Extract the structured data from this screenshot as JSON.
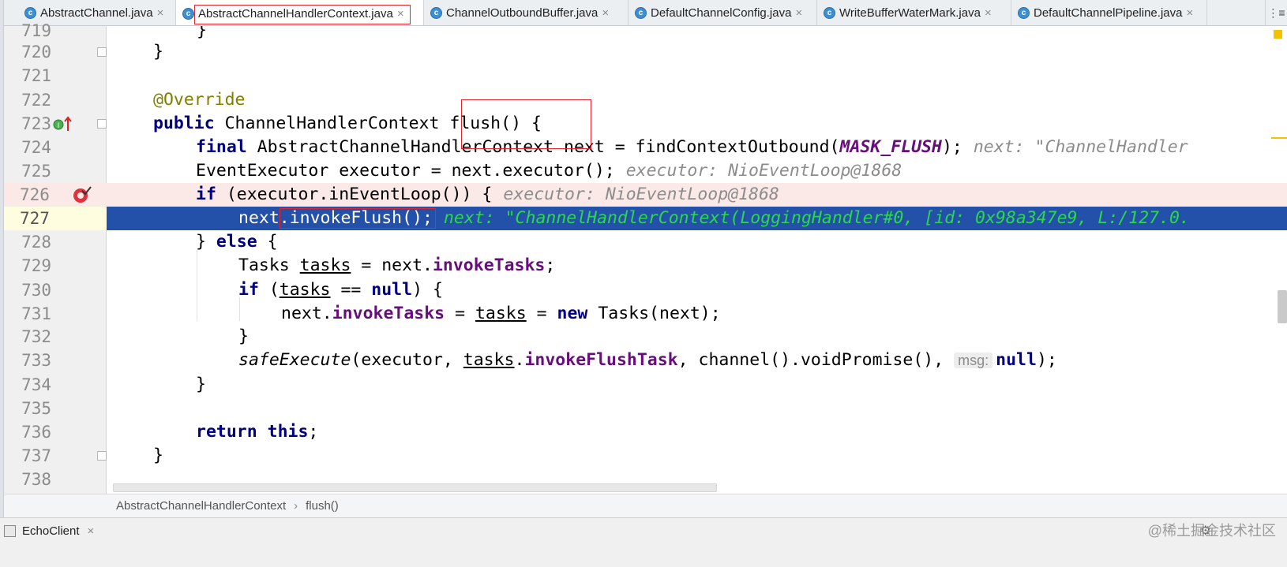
{
  "tabs": [
    {
      "label": "AbstractChannel.java",
      "active": false
    },
    {
      "label": "AbstractChannelHandlerContext.java",
      "active": true
    },
    {
      "label": "ChannelOutboundBuffer.java",
      "active": false
    },
    {
      "label": "DefaultChannelConfig.java",
      "active": false
    },
    {
      "label": "WriteBufferWaterMark.java",
      "active": false
    },
    {
      "label": "DefaultChannelPipeline.java",
      "active": false
    }
  ],
  "tab_icon_letter": "c",
  "tab_close": "×",
  "tab_menu": "⋮≡",
  "line_numbers": [
    "719",
    "720",
    "721",
    "722",
    "723",
    "724",
    "725",
    "726",
    "727",
    "728",
    "729",
    "730",
    "731",
    "732",
    "733",
    "734",
    "735",
    "736",
    "737",
    "738"
  ],
  "code": {
    "l720": "}",
    "l722": "@Override",
    "l723": {
      "kw": "public",
      "type": " ChannelHandlerContext ",
      "name": "flush",
      "rest": "() {"
    },
    "l724": {
      "kw": "final",
      "a": " AbstractChannelHandlerContext next = findContextOutbound(",
      "const": "MASK_FLUSH",
      "b": ");",
      "hint": "next: \"ChannelHandler"
    },
    "l725": {
      "code": "EventExecutor executor = next.executor();",
      "hint": "executor: NioEventLoop@1868"
    },
    "l726": {
      "kw": "if",
      "code": " (executor.inEventLoop()) {",
      "hint": "executor: NioEventLoop@1868"
    },
    "l727": {
      "code": "next.invokeFlush();",
      "hint": "next: \"ChannelHandlerContext(LoggingHandler#0, [id: 0x98a347e9, L:/127.0."
    },
    "l728": {
      "a": "} ",
      "kw": "else",
      "b": " {"
    },
    "l729": {
      "a": "Tasks ",
      "var": "tasks",
      "b": " = next.",
      "fld": "invokeTasks",
      "c": ";"
    },
    "l730": {
      "kw": "if",
      "a": " (",
      "var": "tasks",
      "b": " == ",
      "kw2": "null",
      "c": ") {"
    },
    "l731": {
      "a": "next.",
      "fld": "invokeTasks",
      "b": " = ",
      "var": "tasks",
      "c": " = ",
      "kw": "new",
      "d": " Tasks(next);"
    },
    "l732": "}",
    "l733": {
      "it": "safeExecute",
      "a": "(executor, ",
      "var": "tasks",
      "b": ".",
      "fld": "invokeFlushTask",
      "c": ", channel().voidPromise(), ",
      "param": "msg:",
      "kw": "null",
      "d": ");"
    },
    "l734": "}",
    "l736": {
      "kw": "return",
      "kw2": "this",
      "a": ";"
    },
    "l737": "}"
  },
  "breadcrumb": {
    "class_name": "AbstractChannelHandlerContext",
    "method": "flush()",
    "separator": "›"
  },
  "run_tab": {
    "label": "EchoClient",
    "close": "×"
  },
  "watermark": "@稀土掘金技术社区",
  "colors": {
    "keyword": "#000080",
    "annotation": "#808000",
    "field": "#660e7a",
    "current_line": "#2350a8",
    "breakpoint_line": "#fbe9e7",
    "inline_hint_current": "#2ad84a",
    "highlight_box": "#e0262c"
  }
}
